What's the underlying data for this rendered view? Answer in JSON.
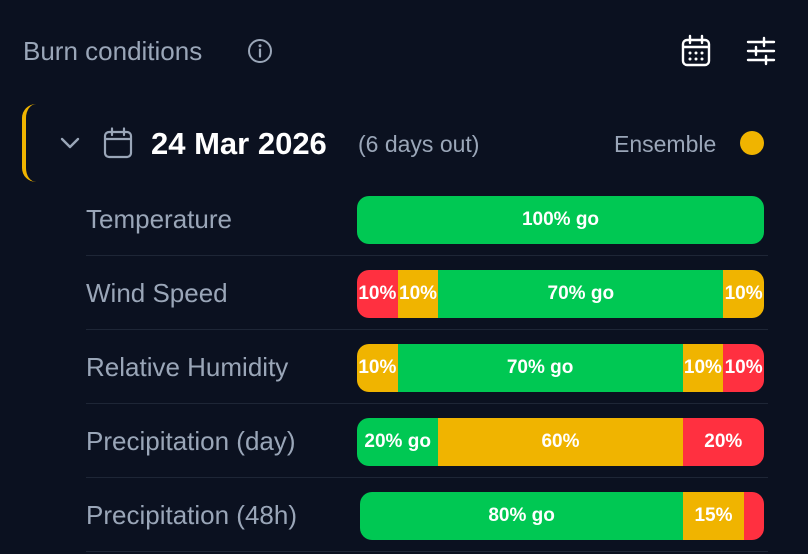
{
  "header": {
    "title": "Burn conditions",
    "icons": {
      "info": "info-icon",
      "calendar": "calendar-icon",
      "filters": "sliders-icon"
    }
  },
  "day": {
    "date": "24 Mar 2026",
    "days_out": "(6 days out)",
    "source": "Ensemble",
    "source_color": "#f0b400",
    "accent_color": "#f0b400",
    "icons": {
      "collapse": "chevron-down-icon",
      "date": "calendar-icon"
    }
  },
  "colors": {
    "go": "#00c853",
    "caution": "#f0b400",
    "nogo": "#ff3040"
  },
  "conditions": [
    {
      "label": "Temperature",
      "segments": [
        {
          "status": "go",
          "percent": 100,
          "label": "100% go"
        }
      ]
    },
    {
      "label": "Wind Speed",
      "segments": [
        {
          "status": "nogo",
          "percent": 10,
          "label": "10%"
        },
        {
          "status": "caution",
          "percent": 10,
          "label": "10%"
        },
        {
          "status": "go",
          "percent": 70,
          "label": "70% go"
        },
        {
          "status": "caution",
          "percent": 10,
          "label": "10%"
        }
      ]
    },
    {
      "label": "Relative Humidity",
      "segments": [
        {
          "status": "caution",
          "percent": 10,
          "label": "10%"
        },
        {
          "status": "go",
          "percent": 70,
          "label": "70% go"
        },
        {
          "status": "caution",
          "percent": 10,
          "label": "10%"
        },
        {
          "status": "nogo",
          "percent": 10,
          "label": "10%"
        }
      ]
    },
    {
      "label": "Precipitation (day)",
      "segments": [
        {
          "status": "go",
          "percent": 20,
          "label": "20% go"
        },
        {
          "status": "caution",
          "percent": 60,
          "label": "60%"
        },
        {
          "status": "nogo",
          "percent": 20,
          "label": "20%"
        }
      ]
    },
    {
      "label": "Precipitation (48h)",
      "segments": [
        {
          "status": "go",
          "percent": 80,
          "label": "80% go"
        },
        {
          "status": "caution",
          "percent": 15,
          "label": "15%"
        },
        {
          "status": "nogo",
          "percent": 5,
          "label": ""
        }
      ]
    }
  ]
}
